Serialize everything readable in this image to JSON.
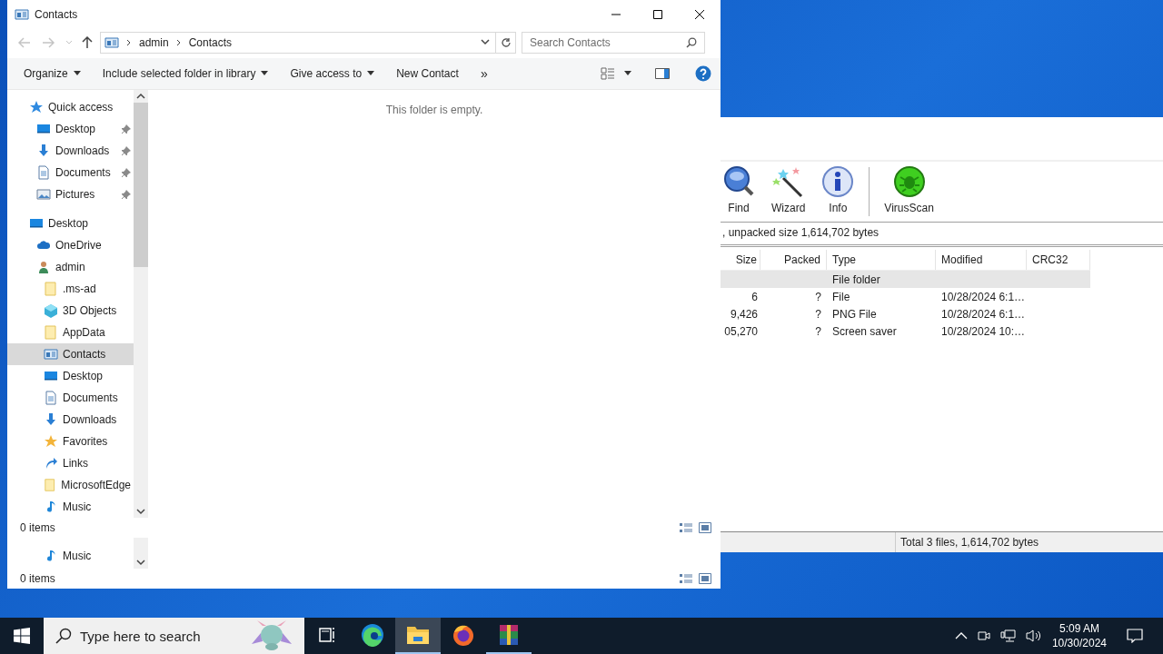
{
  "explorer": {
    "title": "Contacts",
    "path": [
      "admin",
      "Contacts"
    ],
    "search": {
      "placeholder": "Search Contacts"
    },
    "commands": [
      {
        "label": "Organize",
        "dropdown": true
      },
      {
        "label": "Include selected folder in library",
        "dropdown": true
      },
      {
        "label": "Give access to",
        "dropdown": true
      },
      {
        "label": "New Contact",
        "dropdown": false
      }
    ],
    "more": "»",
    "nav": [
      {
        "label": "Quick access",
        "kind": "star",
        "pinned": false,
        "selected": false,
        "children": [
          {
            "label": "Desktop",
            "kind": "desktop",
            "pinned": true,
            "selected": false
          },
          {
            "label": "Downloads",
            "kind": "downloads",
            "pinned": true,
            "selected": false
          },
          {
            "label": "Documents",
            "kind": "documents",
            "pinned": true,
            "selected": false
          },
          {
            "label": "Pictures",
            "kind": "pictures",
            "pinned": true,
            "selected": false
          }
        ]
      },
      {
        "label": "Desktop",
        "kind": "desktop",
        "pinned": false,
        "selected": false,
        "children": [
          {
            "label": "OneDrive",
            "kind": "cloud",
            "pinned": false,
            "selected": false
          },
          {
            "label": "admin",
            "kind": "user",
            "pinned": false,
            "selected": false,
            "children": [
              {
                "label": ".ms-ad",
                "kind": "folder",
                "pinned": false,
                "selected": false
              },
              {
                "label": "3D Objects",
                "kind": "cube",
                "pinned": false,
                "selected": false
              },
              {
                "label": "AppData",
                "kind": "folder",
                "pinned": false,
                "selected": false
              },
              {
                "label": "Contacts",
                "kind": "contacts",
                "pinned": false,
                "selected": true
              },
              {
                "label": "Desktop",
                "kind": "desktop",
                "pinned": false,
                "selected": false
              },
              {
                "label": "Documents",
                "kind": "documents",
                "pinned": false,
                "selected": false
              },
              {
                "label": "Downloads",
                "kind": "downloads",
                "pinned": false,
                "selected": false
              },
              {
                "label": "Favorites",
                "kind": "favorite",
                "pinned": false,
                "selected": false
              },
              {
                "label": "Links",
                "kind": "links",
                "pinned": false,
                "selected": false
              },
              {
                "label": "MicrosoftEdge",
                "kind": "folder",
                "pinned": false,
                "selected": false
              },
              {
                "label": "Music",
                "kind": "music",
                "pinned": false,
                "selected": false
              }
            ]
          }
        ]
      }
    ],
    "empty_message": "This folder is empty.",
    "status": "0 items",
    "ghost": {
      "item": {
        "label": "Music",
        "kind": "music"
      },
      "status": "0 items"
    }
  },
  "winrar": {
    "tool_groups": [
      [
        {
          "label": "Find",
          "kind": "find"
        },
        {
          "label": "Wizard",
          "kind": "wizard"
        },
        {
          "label": "Info",
          "kind": "info"
        }
      ],
      [
        {
          "label": "VirusScan",
          "kind": "virus"
        }
      ]
    ],
    "info": ", unpacked size 1,614,702 bytes",
    "columns": [
      "Size",
      "Packed",
      "Type",
      "Modified",
      "CRC32"
    ],
    "rows": [
      {
        "type": "File folder",
        "selected": true
      },
      {
        "size": "6",
        "packed": "?",
        "type": "File",
        "modified": "10/28/2024 6:1…",
        "selected": false
      },
      {
        "size": "9,426",
        "packed": "?",
        "type": "PNG File",
        "modified": "10/28/2024 6:1…",
        "selected": false
      },
      {
        "size": "05,270",
        "packed": "?",
        "type": "Screen saver",
        "modified": "10/28/2024 10:…",
        "selected": false
      }
    ],
    "status": "Total 3 files, 1,614,702 bytes"
  },
  "taskbar": {
    "search_placeholder": "Type here to search",
    "apps": [
      {
        "kind": "task-view",
        "active": false,
        "running": false
      },
      {
        "kind": "edge",
        "active": false,
        "running": false
      },
      {
        "kind": "explorer",
        "active": true,
        "running": true
      },
      {
        "kind": "firefox",
        "active": false,
        "running": false
      },
      {
        "kind": "winrar",
        "active": false,
        "running": true
      }
    ],
    "time": "5:09 AM",
    "date": "10/30/2024"
  }
}
